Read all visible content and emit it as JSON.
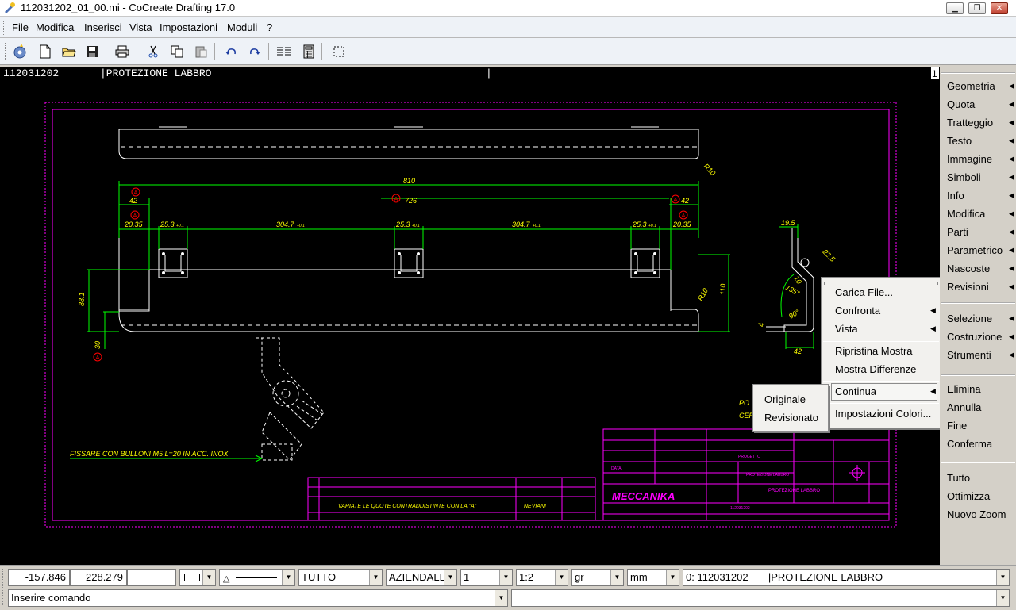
{
  "window": {
    "title": "112031202_01_00.mi - CoCreate Drafting 17.0",
    "controls": [
      "minimize-icon",
      "restore-icon",
      "close-icon"
    ]
  },
  "menubar": {
    "items": [
      "File",
      "Modifica",
      "Inserisci",
      "Vista",
      "Impostazioni",
      "Moduli",
      "?"
    ]
  },
  "toolbar": {
    "buttons": [
      "wizard-icon",
      "new-file-icon",
      "open-folder-icon",
      "save-icon",
      "print-icon",
      "cut-icon",
      "copy-icon",
      "paste-icon",
      "undo-icon",
      "redo-icon",
      "list-icon",
      "calculator-icon",
      "select-box-icon"
    ]
  },
  "canvas": {
    "header_code": "112031202",
    "header_name": "|PROTEZIONE LABBRO",
    "header_cursor": "|",
    "page_number": "1",
    "dims": {
      "d810": "810",
      "d726": "726",
      "d42a": "42",
      "d42b": "42",
      "d2035a": "20.35",
      "d2035b": "20.35",
      "d253a": "25.3",
      "d253b": "25.3",
      "d253c": "25.3",
      "d3047a": "304.7",
      "d3047b": "304.7",
      "d881": "88.1",
      "d30": "30",
      "d110": "110",
      "r10a": "R10",
      "r10b": "R10",
      "d195": "19.5",
      "d225": "22.5",
      "d135": "135°",
      "d90": "90°",
      "d4": "4",
      "d42c": "42",
      "d10": "10",
      "tol": "+0.1",
      "markA": "A"
    },
    "note": "FISSARE CON BULLONI M5 L=20 IN ACC. INOX",
    "revision_note": "VARIATE LE QUOTE CONTRADDISTINTE CON LA \"A\"",
    "revision_author": "NEVIANI",
    "partial_text": [
      "PO",
      "CER"
    ],
    "titleblock_logo": "MECCANIKA",
    "titleblock_part": "PROTEZIONE LABBRO"
  },
  "sidepanel": {
    "group1": [
      "Geometria",
      "Quota",
      "Tratteggio",
      "Testo",
      "Immagine",
      "Simboli",
      "Info",
      "Modifica",
      "Parti",
      "Parametrico",
      "Nascoste",
      "Revisioni"
    ],
    "group2": [
      "Selezione",
      "Costruzione",
      "Strumenti"
    ],
    "group3": [
      "Elimina",
      "Annulla",
      "Fine",
      "Conferma"
    ],
    "group4": [
      "Tutto",
      "Ottimizza",
      "Nuovo Zoom"
    ]
  },
  "context_menu": {
    "items": [
      {
        "label": "Carica File...",
        "submenu": false
      },
      {
        "label": "Confronta",
        "submenu": true
      },
      {
        "label": "Vista",
        "submenu": true
      },
      {
        "label": "Ripristina Mostra",
        "submenu": false
      },
      {
        "label": "Mostra Differenze",
        "submenu": false
      },
      {
        "label": "Continua",
        "submenu": true
      },
      {
        "label": "Impostazioni Colori...",
        "submenu": false
      }
    ]
  },
  "submenu": {
    "items": [
      "Originale",
      "Revisionato"
    ]
  },
  "statusbar": {
    "x_coord": "-157.846",
    "y_coord": "228.279",
    "layer": "TUTTO",
    "style": "AZIENDALE",
    "sheet": "1",
    "scale": "1:2",
    "angle_unit": "gr",
    "length_unit": "mm",
    "part_info": "0: 112031202       |PROTEZIONE LABBRO",
    "command_placeholder": "Inserire comando",
    "command_value": "Inserire comando"
  },
  "colors": {
    "canvas_bg": "#000000",
    "geometry": "#ffffff",
    "dimension": "#00ff00",
    "annotation": "#ffff00",
    "frame": "#ff00ff",
    "revision_mark": "#ff0000"
  }
}
